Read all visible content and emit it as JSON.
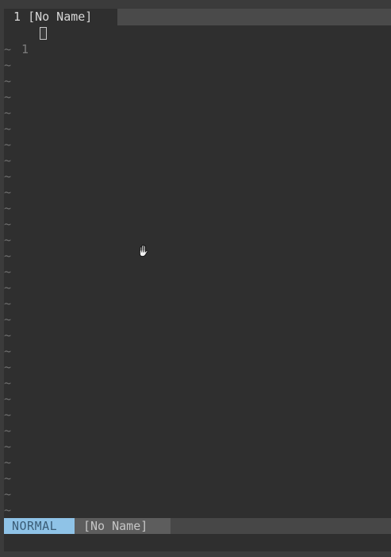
{
  "tabline": {
    "tab_number": "1",
    "tab_label": "[No Name]"
  },
  "buffer": {
    "lines": [
      {
        "number": "1",
        "text": ""
      }
    ],
    "empty_line_marker": "~"
  },
  "statusline": {
    "mode": "NORMAL",
    "filename": "[No Name]"
  },
  "cmdline": {
    "text": ""
  },
  "colors": {
    "background": "#2f2f2f",
    "mode_bg": "#8fc3e7",
    "mode_fg": "#3b5d77"
  },
  "icons": {
    "mouse_pointer": "grab-hand-icon"
  }
}
